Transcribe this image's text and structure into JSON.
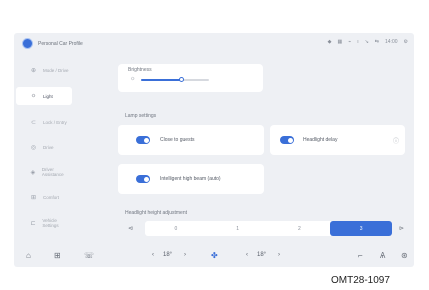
{
  "profile": {
    "name": "Personal Car Profile"
  },
  "status_bar": {
    "icons": [
      "wifi-icon",
      "bluetooth-icon",
      "mobile-data-icon",
      "signal-icon",
      "volume-icon",
      "connection-icon",
      "time-text",
      "settings-icon"
    ],
    "time": "14:00"
  },
  "sidebar": {
    "items": [
      {
        "label": "Mode / Drive",
        "icon": "car-icon",
        "active": false
      },
      {
        "label": "Light",
        "icon": "light-icon",
        "active": true
      },
      {
        "label": "Lock / Entry",
        "icon": "lock-icon",
        "active": false
      },
      {
        "label": "Drive",
        "icon": "steering-icon",
        "active": false
      },
      {
        "label": "Driver Assistance",
        "icon": "assist-icon",
        "active": false
      },
      {
        "label": "Comfort",
        "icon": "seat-icon",
        "active": false
      },
      {
        "label": "Vehicle Settings",
        "icon": "vehicle-icon",
        "active": false
      }
    ]
  },
  "main": {
    "brightness": {
      "title": "Brightness",
      "value": 0.6
    },
    "lights_section_title": "Lamp settings",
    "toggles": [
      {
        "label": "Close to guests",
        "on": true
      },
      {
        "label": "Headlight delay",
        "on": true
      },
      {
        "label": "Intelligent high beam (auto)",
        "on": true
      }
    ],
    "headlight_height": {
      "title": "Headlight height adjustment",
      "options": [
        "0",
        "1",
        "2",
        "3"
      ],
      "selected": 3
    }
  },
  "bottom_bar": {
    "left_temp": "18°",
    "right_temp": "18°"
  },
  "caption": "OMT28-1097",
  "colors": {
    "accent": "#3a6fd8",
    "background": "#eef0f4",
    "card": "#ffffff"
  }
}
